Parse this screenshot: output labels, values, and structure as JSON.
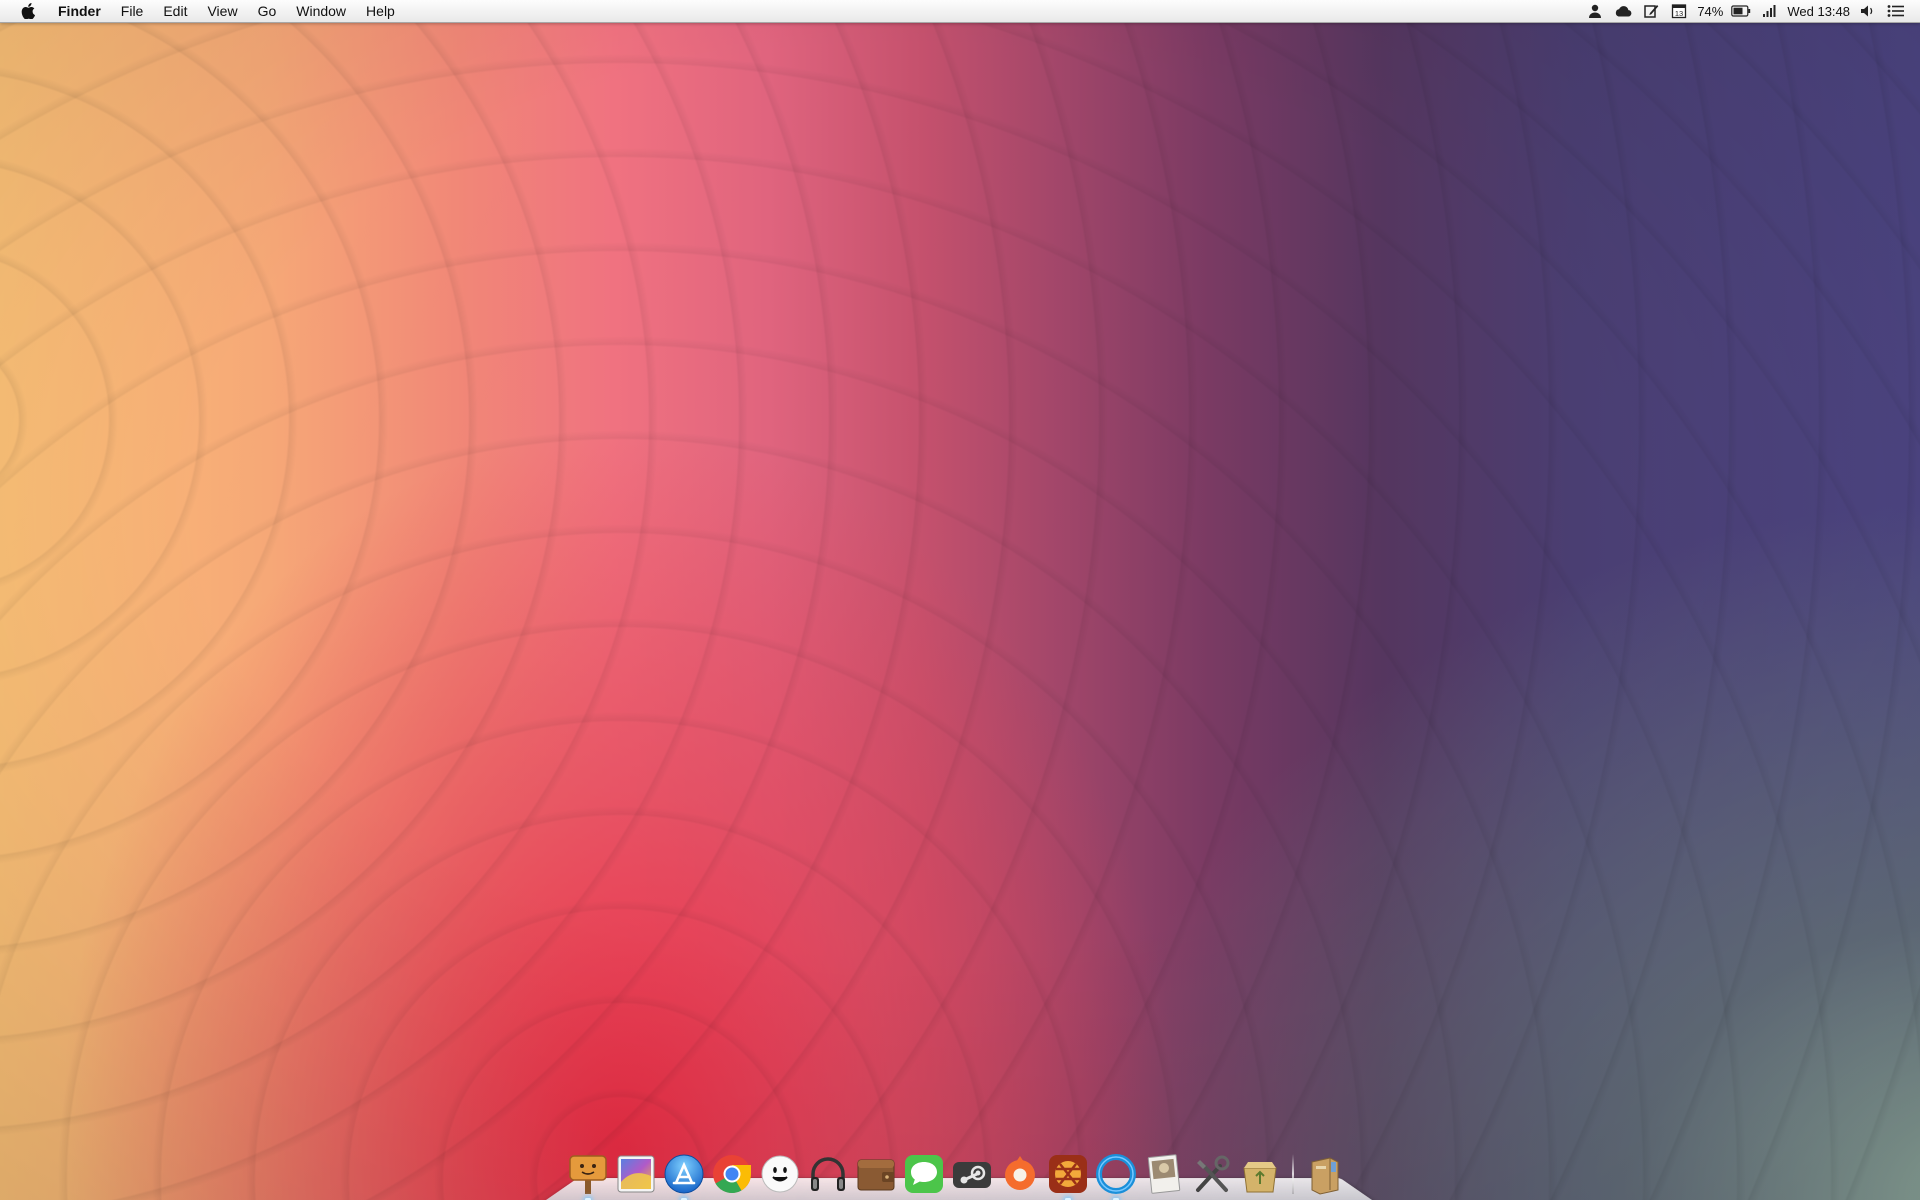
{
  "menubar": {
    "apple_icon": "apple-logo-icon",
    "app_name": "Finder",
    "menus": [
      "File",
      "Edit",
      "View",
      "Go",
      "Window",
      "Help"
    ],
    "status": {
      "icons": [
        "user-icon",
        "cloud-icon",
        "note-edit-icon",
        "calendar-icon"
      ],
      "calendar_day": "13",
      "battery_percent": "74%",
      "battery_icon": "battery-icon",
      "wifi_icon": "signal-bars-icon",
      "clock": "Wed 13:48",
      "volume_icon": "speaker-icon",
      "list_icon": "notification-list-icon"
    }
  },
  "wallpaper": {
    "colors": [
      "#fcc177",
      "#f07280",
      "#e8283f",
      "#7a3a63",
      "#4a3e72",
      "#96b4a0"
    ]
  },
  "dock": {
    "apps": [
      {
        "name": "Stickies sign",
        "icon": "signpost-icon",
        "color": "#d98b34",
        "running": true
      },
      {
        "name": "Photo app",
        "icon": "photo-gradient-icon",
        "color": "#7a5cc8",
        "running": false
      },
      {
        "name": "App Store",
        "icon": "app-store-icon",
        "color": "#2f8fe8",
        "running": true
      },
      {
        "name": "Chrome",
        "icon": "chrome-icon",
        "color": "#e94235",
        "running": false
      },
      {
        "name": "Messenger face",
        "icon": "smiley-face-icon",
        "color": "#f4f4f4",
        "running": false
      },
      {
        "name": "Headphones",
        "icon": "headphones-icon",
        "color": "#444444",
        "running": false
      },
      {
        "name": "Wallet",
        "icon": "wallet-icon",
        "color": "#8a5a33",
        "running": false
      },
      {
        "name": "Messages",
        "icon": "messages-bubble-icon",
        "color": "#4cc54a",
        "running": false
      },
      {
        "name": "Steam",
        "icon": "steam-icon",
        "color": "#3b3b3b",
        "running": false
      },
      {
        "name": "Origin",
        "icon": "origin-icon",
        "color": "#f56c2d",
        "running": false
      },
      {
        "name": "Rdio",
        "icon": "rdio-icon",
        "color": "#b83d1f",
        "running": true
      },
      {
        "name": "Circle app",
        "icon": "blue-ring-icon",
        "color": "#1a8fd9",
        "running": true
      },
      {
        "name": "Preview",
        "icon": "preview-photos-icon",
        "color": "#d9d0c0",
        "running": false
      },
      {
        "name": "Utilities",
        "icon": "tools-icon",
        "color": "#555555",
        "running": false
      },
      {
        "name": "Recycle",
        "icon": "recycle-box-icon",
        "color": "#d4b36a",
        "running": false
      },
      {
        "name": "Archive",
        "icon": "archive-box-icon",
        "color": "#c9a063",
        "running": false
      }
    ]
  }
}
